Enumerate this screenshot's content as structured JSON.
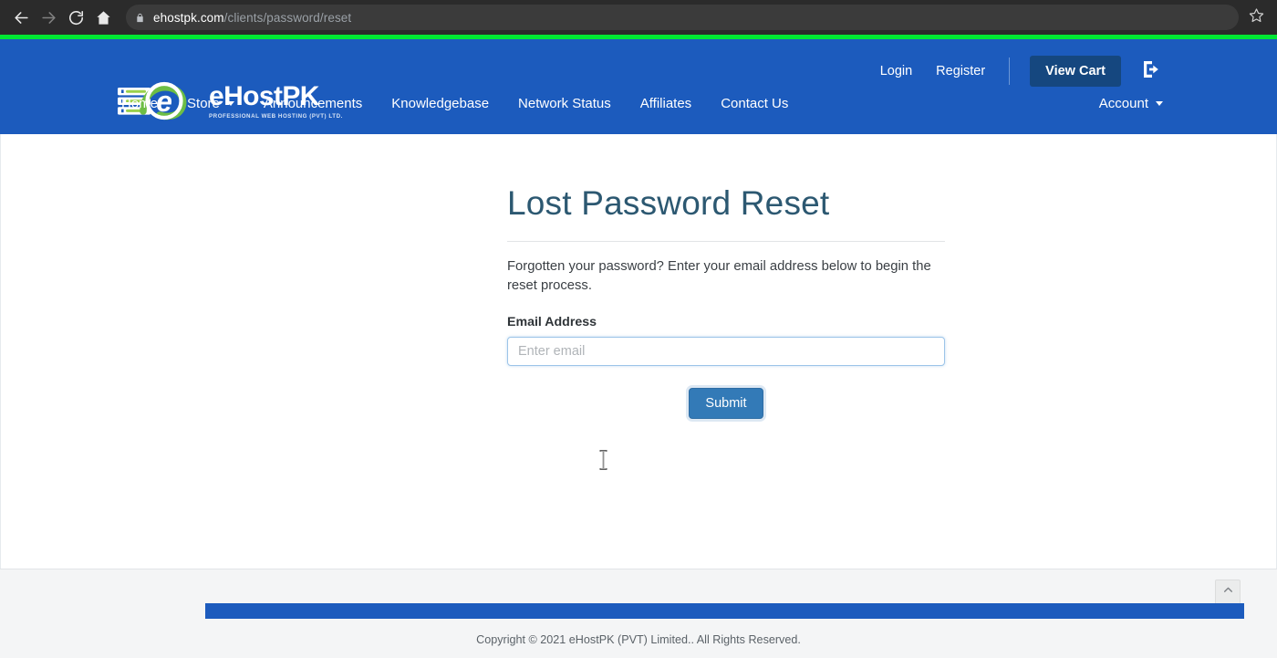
{
  "browser": {
    "back_icon": "back-arrow-icon",
    "forward_icon": "forward-arrow-icon",
    "reload_icon": "reload-icon",
    "home_icon": "home-icon",
    "lock_icon": "lock-icon",
    "star_icon": "bookmark-star-icon",
    "url_host": "ehostpk.com",
    "url_path": "/clients/password/reset",
    "progress_color": "#00e833"
  },
  "header": {
    "logo": {
      "name": "eHostPK",
      "tagline": "PROFESSIONAL WEB HOSTING (PVT) LTD.",
      "mark_icon": "ehostpk-server-cloud-logo-icon"
    },
    "top_links": [
      {
        "label": "Login"
      },
      {
        "label": "Register"
      }
    ],
    "cart_button": "View Cart",
    "logout_icon": "logout-icon",
    "nav": [
      {
        "label": "Home",
        "has_caret": false
      },
      {
        "label": "Store",
        "has_caret": true
      },
      {
        "label": "Announcements",
        "has_caret": false
      },
      {
        "label": "Knowledgebase",
        "has_caret": false
      },
      {
        "label": "Network Status",
        "has_caret": false
      },
      {
        "label": "Affiliates",
        "has_caret": false
      },
      {
        "label": "Contact Us",
        "has_caret": false
      }
    ],
    "account": {
      "label": "Account",
      "has_caret": true
    },
    "background_color": "#1c5bbd"
  },
  "main": {
    "title": "Lost Password Reset",
    "intro": "Forgotten your password? Enter your email address below to begin the reset process.",
    "email_label": "Email Address",
    "email_value": "",
    "email_placeholder": "Enter email",
    "submit_label": "Submit",
    "accent_color": "#337ab7",
    "title_color": "#2c5871"
  },
  "footer": {
    "copyright": "Copyright © 2021 eHostPK (PVT) Limited.. All Rights Reserved.",
    "bar_color": "#1c5bbd",
    "scroll_top_icon": "chevron-up-icon"
  }
}
